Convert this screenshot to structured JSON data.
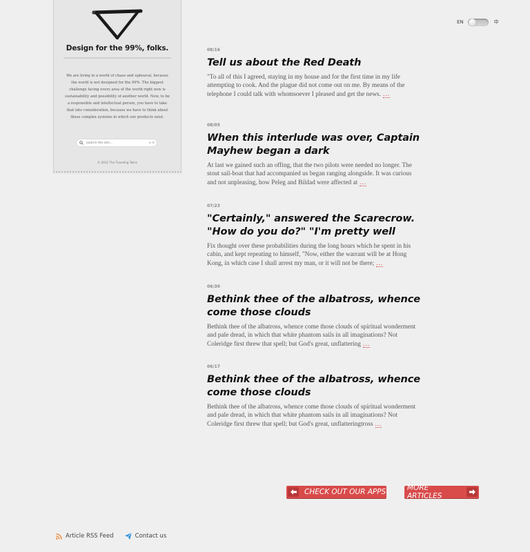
{
  "sidebar": {
    "title": "Design for the 99%, folks.",
    "text": "We are living in a world of chaos and upheaval, because the world is not designed for the 99%. The biggest challenge facing every area of the world right now is sustainability and possibility of another world. Now, to be a responsible and intellectual person, you have to take that into consideration, because we have to think about these complex systems in which our products exist.",
    "search_placeholder": "Search the site...",
    "search_button": "▸ ≡",
    "copyright": "© 2012 The Traveling Twins"
  },
  "lang": {
    "en": "EN",
    "zh": "中"
  },
  "articles": [
    {
      "date": "08/16",
      "title": "Tell us about the Red Death",
      "body": "\"To all of this I agreed, staying in my house and for the first time in  my life attempting to cook. And the plague did not come out on me. By  means of the telephone I could talk with whomsoever I pleased and get  the news.",
      "more": "..."
    },
    {
      "date": "08/05",
      "title": "When this interlude was over, Captain Mayhew began a dark",
      "body": "At last we gained such an offing, that the two pilots were needed no longer. The stout sail-boat that had accompanied us began ranging alongside. It was curious and not unpleasing, how Peleg and Bildad were affected at",
      "more": "..."
    },
    {
      "date": "07/23",
      "title": "\"Certainly,\" answered the Scarecrow. \"How do you do?\" \"I'm pretty well",
      "body": "Fix thought over these probabilities during the long hours which he spent in his cabin, and kept repeating to himself, \"Now, either the warrant will be at Hong Kong, in which case I shall arrest my man, or it will not be there;",
      "more": "..."
    },
    {
      "date": "06/30",
      "title": "Bethink thee of the albatross, whence come those clouds",
      "body": "Bethink thee of the albatross, whence come those clouds of spiritual wonderment and pale dread, in which that white phantom sails in all imaginations? Not Coleridge first threw that spell; but God's great, unflattering",
      "more": "..."
    },
    {
      "date": "06/17",
      "title": "Bethink thee of the albatross, whence come those clouds",
      "body": "Bethink thee of the albatross, whence come those clouds of spiritual wonderment and pale dread, in which that white phantom sails in all imaginations? Not Coleridge first threw that spell; but God's great, unflatteringtross",
      "more": "..."
    }
  ],
  "buttons": {
    "apps": "CHECK OUT OUR APPS",
    "more": "MORE ARTICLES"
  },
  "footer": {
    "rss": "Article RSS Feed",
    "contact": "Contact us"
  },
  "colors": {
    "accent": "#d94b4b",
    "rss": "#f0883a",
    "contact": "#2a8fd6"
  },
  "icons": [
    "triangle-logo-icon",
    "search-icon",
    "arrow-left-icon",
    "arrow-right-icon",
    "rss-icon",
    "paper-plane-icon"
  ]
}
